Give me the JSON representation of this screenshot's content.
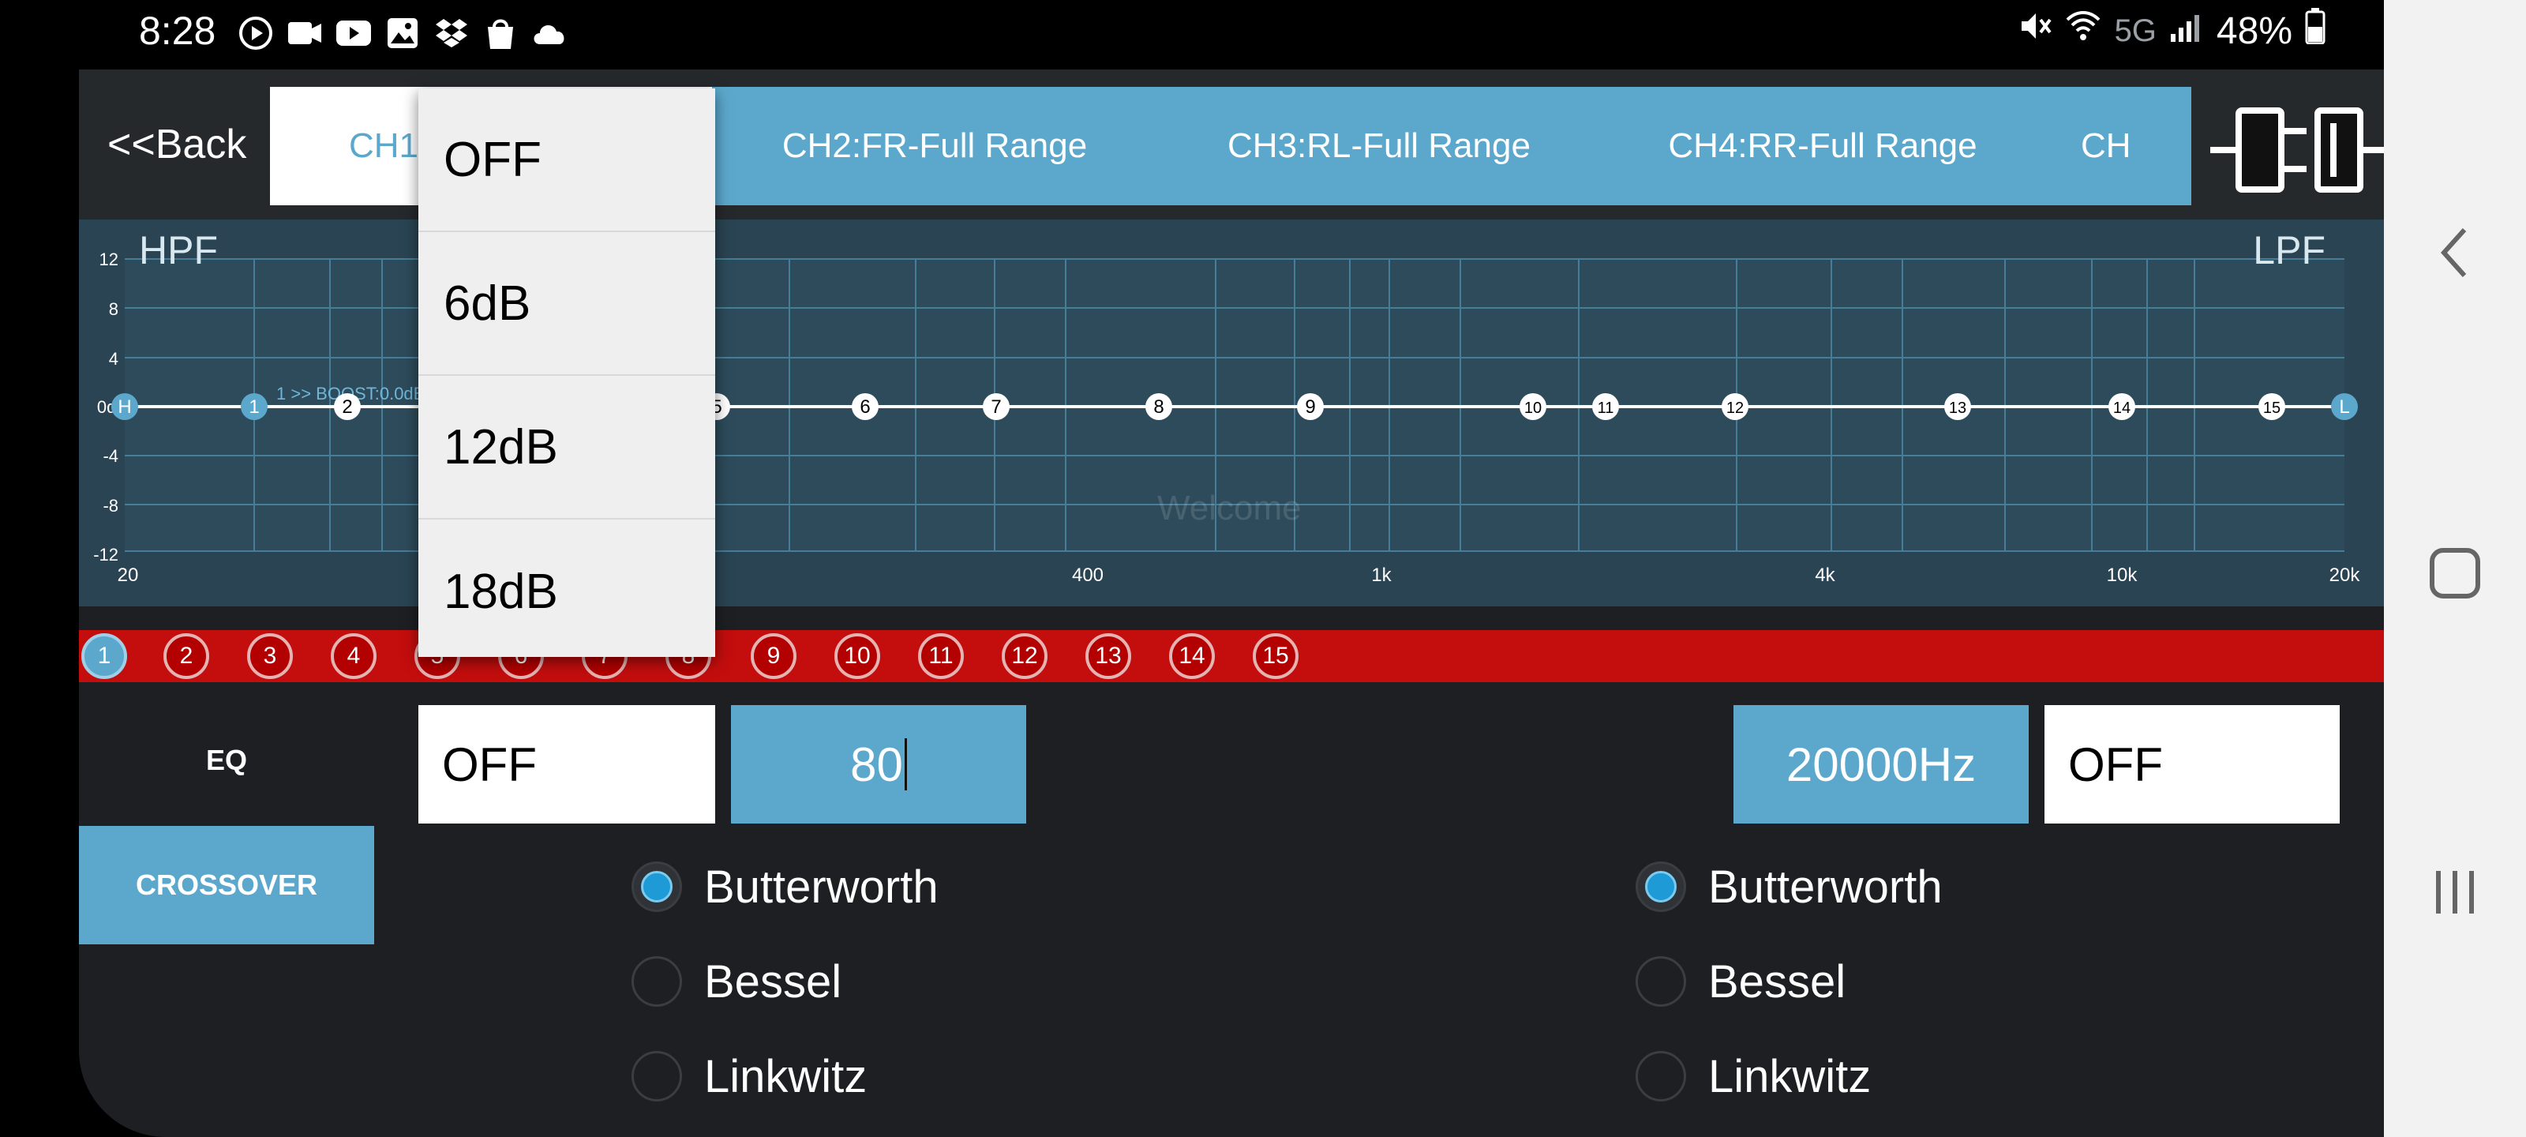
{
  "status": {
    "time": "8:28",
    "network": "5G",
    "battery": "48%"
  },
  "header": {
    "back_label": "<<Back",
    "tabs": [
      {
        "label": "CH1"
      },
      {
        "label": "CH2:FR-Full Range"
      },
      {
        "label": "CH3:RL-Full Range"
      },
      {
        "label": "CH4:RR-Full Range"
      },
      {
        "label": "CH"
      }
    ]
  },
  "graph": {
    "hpf_label": "HPF",
    "lpf_label": "LPF",
    "y_ticks": [
      "12",
      "8",
      "4",
      "0dB",
      "-4",
      "-8",
      "-12"
    ],
    "x_ticks": [
      "20",
      "400",
      "1k",
      "4k",
      "10k",
      "20k"
    ],
    "boost_label": "1 >>  BOOST:0.0dB",
    "watermark": "Welcome",
    "nodes": [
      "H",
      "1",
      "2",
      "5",
      "6",
      "7",
      "8",
      "9",
      "10",
      "11",
      "12",
      "13",
      "14",
      "15",
      "L"
    ]
  },
  "bands": [
    "1",
    "2",
    "3",
    "4",
    "5",
    "6",
    "7",
    "8",
    "9",
    "10",
    "11",
    "12",
    "13",
    "14",
    "15"
  ],
  "menu": {
    "eq_label": "EQ",
    "crossover_label": "CROSSOVER"
  },
  "crossover": {
    "hpf_slope": "OFF",
    "hpf_freq": "80",
    "lpf_freq": "20000Hz",
    "lpf_slope": "OFF",
    "filter_types": [
      "Butterworth",
      "Bessel",
      "Linkwitz"
    ],
    "hpf_selected": "Butterworth",
    "lpf_selected": "Butterworth"
  },
  "dropdown": {
    "options": [
      "OFF",
      "6dB",
      "12dB",
      "18dB"
    ]
  },
  "colors": {
    "accent": "#5ca8cd",
    "band_strip": "#c40d0d",
    "background": "#1d1f22"
  }
}
